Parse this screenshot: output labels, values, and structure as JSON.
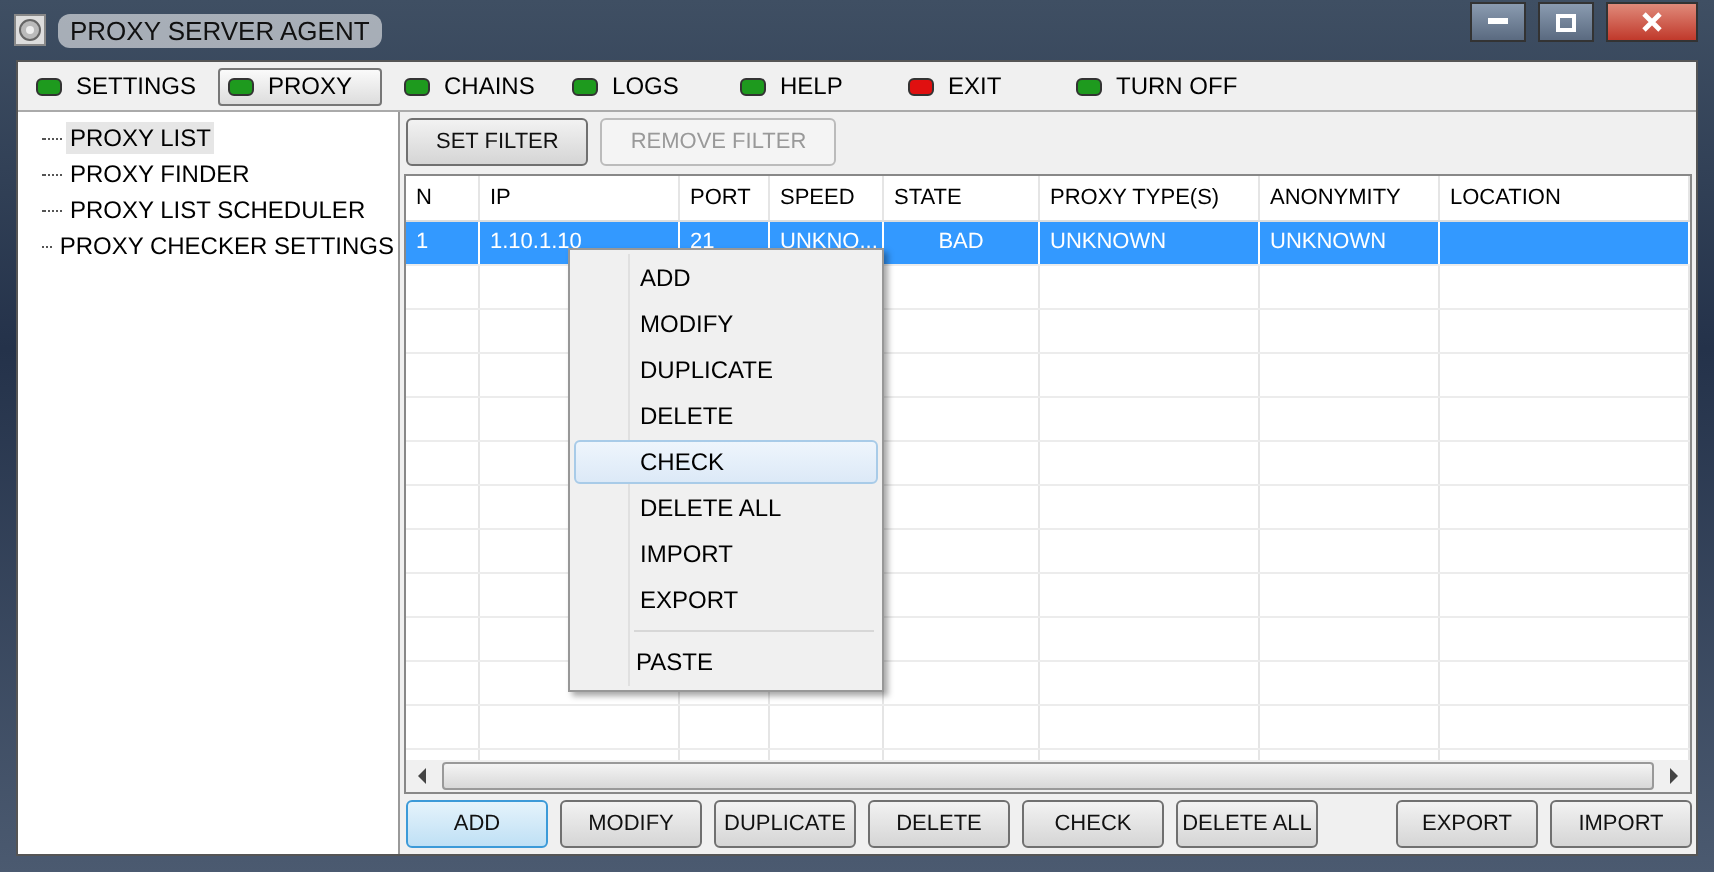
{
  "window": {
    "title": "PROXY SERVER AGENT"
  },
  "menu": [
    {
      "label": "SETTINGS",
      "color": "#1e9a1e",
      "selected": false
    },
    {
      "label": "PROXY",
      "color": "#1e9a1e",
      "selected": true
    },
    {
      "label": "CHAINS",
      "color": "#1e9a1e",
      "selected": false
    },
    {
      "label": "LOGS",
      "color": "#1e9a1e",
      "selected": false
    },
    {
      "label": "HELP",
      "color": "#1e9a1e",
      "selected": false
    },
    {
      "label": "EXIT",
      "color": "#e01010",
      "selected": false
    },
    {
      "label": "TURN OFF",
      "color": "#1e9a1e",
      "selected": false
    }
  ],
  "sidebar": {
    "items": [
      {
        "label": "PROXY LIST",
        "selected": true
      },
      {
        "label": "PROXY FINDER",
        "selected": false
      },
      {
        "label": "PROXY LIST SCHEDULER",
        "selected": false
      },
      {
        "label": "PROXY CHECKER SETTINGS",
        "selected": false
      }
    ]
  },
  "filter_buttons": [
    {
      "label": "SET FILTER",
      "disabled": false
    },
    {
      "label": "REMOVE FILTER",
      "disabled": true
    }
  ],
  "table": {
    "columns": [
      "N",
      "IP",
      "PORT",
      "SPEED",
      "STATE",
      "PROXY TYPE(S)",
      "ANONYMITY",
      "LOCATION"
    ],
    "rows": [
      {
        "cells": [
          "1",
          "1.10.1.10",
          "21",
          "UNKNO...",
          "BAD",
          "UNKNOWN",
          "UNKNOWN",
          ""
        ],
        "selected": true
      }
    ]
  },
  "context_menu": [
    {
      "label": "ADD",
      "selected": false
    },
    {
      "label": "MODIFY",
      "selected": false
    },
    {
      "label": "DUPLICATE",
      "selected": false
    },
    {
      "label": "DELETE",
      "selected": false
    },
    {
      "label": "CHECK",
      "selected": true
    },
    {
      "label": "DELETE ALL",
      "selected": false
    },
    {
      "label": "IMPORT",
      "selected": false
    },
    {
      "label": "EXPORT",
      "selected": false
    },
    {
      "label": "PASTE",
      "selected": false,
      "separator_before": true
    }
  ],
  "bottom_buttons": [
    {
      "label": "ADD",
      "focused": true
    },
    {
      "label": "MODIFY",
      "focused": false
    },
    {
      "label": "DUPLICATE",
      "focused": false
    },
    {
      "label": "DELETE",
      "focused": false
    },
    {
      "label": "CHECK",
      "focused": false
    },
    {
      "label": "DELETE ALL",
      "focused": false
    },
    {
      "label": "EXPORT",
      "focused": false
    },
    {
      "label": "IMPORT",
      "focused": false
    }
  ]
}
